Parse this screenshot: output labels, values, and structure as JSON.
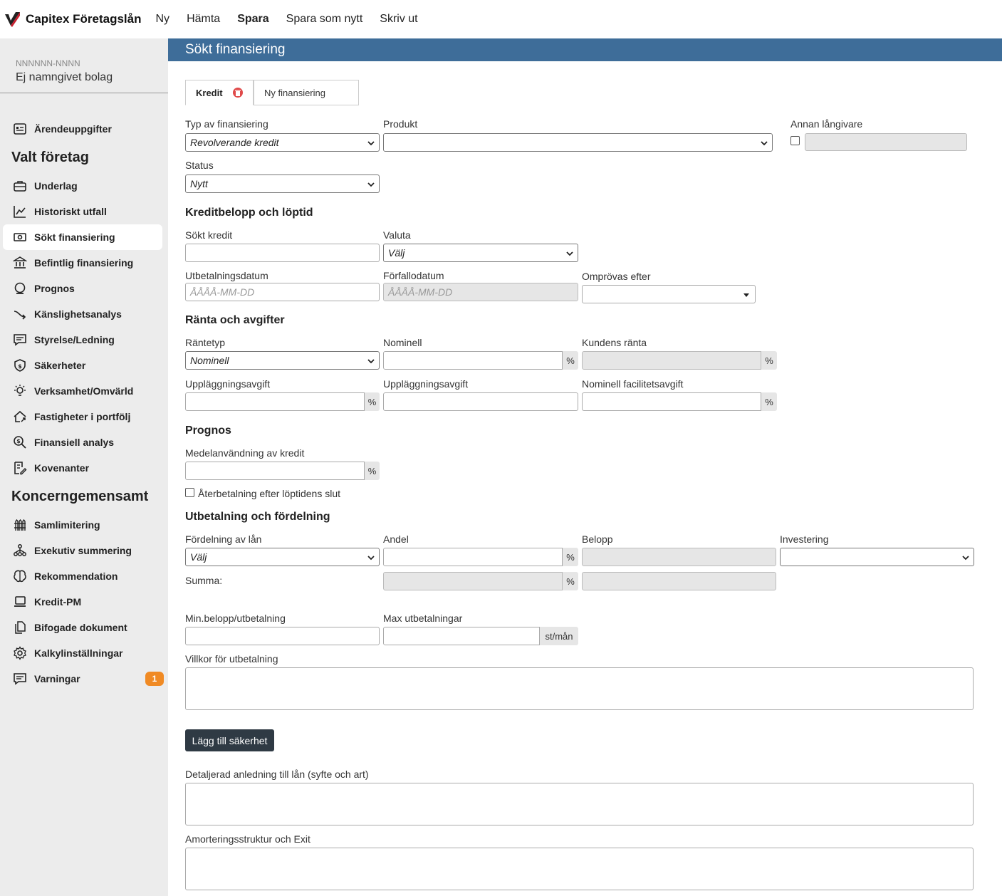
{
  "app": {
    "brand": "Capitex Företagslån",
    "nav": [
      "Ny",
      "Hämta",
      "Spara",
      "Spara som nytt",
      "Skriv ut"
    ]
  },
  "org": {
    "number": "NNNNNN-NNNN",
    "name": "Ej namngivet bolag"
  },
  "sidebar": {
    "top_item": "Ärendeuppgifter",
    "section1_title": "Valt företag",
    "section1_items": [
      "Underlag",
      "Historiskt utfall",
      "Sökt finansiering",
      "Befintlig finansiering",
      "Prognos",
      "Känslighetsanalys",
      "Styrelse/Ledning",
      "Säkerheter",
      "Verksamhet/Omvärld",
      "Fastigheter i portfölj",
      "Finansiell analys",
      "Kovenanter"
    ],
    "section2_title": "Koncerngemensamt",
    "section2_items": [
      "Samlimitering",
      "Exekutiv summering",
      "Rekommendation",
      "Kredit-PM",
      "Bifogade dokument",
      "Kalkylinställningar",
      "Varningar"
    ],
    "warnings_count": "1",
    "active": "Sökt finansiering"
  },
  "page": {
    "title": "Sökt finansiering",
    "tabs": [
      "Kredit",
      "Ny finansiering"
    ]
  },
  "form": {
    "typ_label": "Typ av finansiering",
    "typ_value": "Revolverande kredit",
    "produkt_label": "Produkt",
    "produkt_value": "",
    "annan_label": "Annan långivare",
    "status_label": "Status",
    "status_value": "Nytt",
    "sec_kredit": "Kreditbelopp och löptid",
    "sokt_kredit_label": "Sökt kredit",
    "valuta_label": "Valuta",
    "valuta_value": "Välj",
    "utbet_datum_label": "Utbetalningsdatum",
    "utbet_datum_placeholder": "ÅÅÅÅ-MM-DD",
    "forfall_label": "Förfallodatum",
    "forfall_placeholder": "ÅÅÅÅ-MM-DD",
    "omprovas_label": "Omprövas efter",
    "sec_ranta": "Ränta och avgifter",
    "rantetyp_label": "Räntetyp",
    "rantetyp_value": "Nominell",
    "nominell_label": "Nominell",
    "kundens_ranta_label": "Kundens ränta",
    "upplagg1_label": "Uppläggningsavgift",
    "upplagg2_label": "Uppläggningsavgift",
    "nom_fac_label": "Nominell facilitetsavgift",
    "percent": "%",
    "sec_prognos": "Prognos",
    "medel_label": "Medelanvändning av kredit",
    "aterbet_label": "Återbetalning efter löptidens slut",
    "sec_utbet": "Utbetalning och fördelning",
    "fordelning_label": "Fördelning av lån",
    "fordelning_value": "Välj",
    "andel_label": "Andel",
    "belopp_label": "Belopp",
    "investering_label": "Investering",
    "summa_label": "Summa:",
    "min_belopp_label": "Min.belopp/utbetalning",
    "max_utbet_label": "Max utbetalningar",
    "st_man": "st/mån",
    "villkor_label": "Villkor för utbetalning",
    "add_sakerhet_button": "Lägg till säkerhet",
    "detaljerad_label": "Detaljerad anledning till lån (syfte och art)",
    "amort_label": "Amorteringsstruktur och Exit"
  }
}
